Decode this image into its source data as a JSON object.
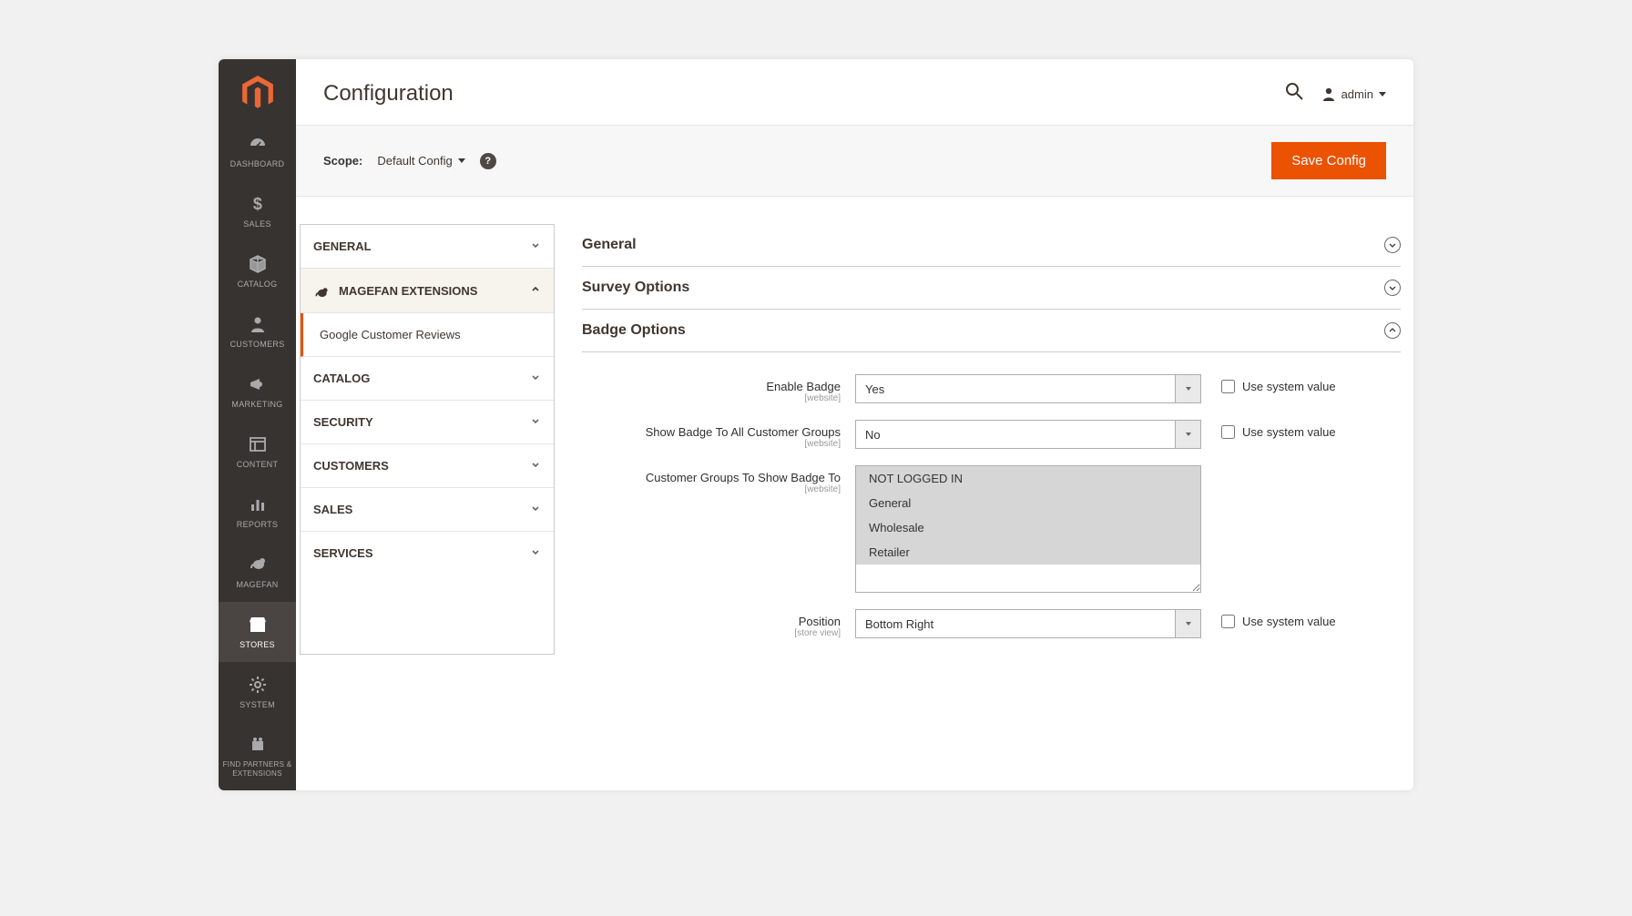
{
  "header": {
    "title": "Configuration",
    "user": "admin"
  },
  "scope": {
    "label": "Scope:",
    "value": "Default Config",
    "save_label": "Save Config"
  },
  "sidebar": [
    {
      "label": "DASHBOARD",
      "icon": "dashboard"
    },
    {
      "label": "SALES",
      "icon": "dollar"
    },
    {
      "label": "CATALOG",
      "icon": "cube"
    },
    {
      "label": "CUSTOMERS",
      "icon": "person"
    },
    {
      "label": "MARKETING",
      "icon": "megaphone"
    },
    {
      "label": "CONTENT",
      "icon": "layout"
    },
    {
      "label": "REPORTS",
      "icon": "bars"
    },
    {
      "label": "MAGEFAN",
      "icon": "elephant"
    },
    {
      "label": "STORES",
      "icon": "store",
      "active": true
    },
    {
      "label": "SYSTEM",
      "icon": "gear"
    },
    {
      "label": "FIND PARTNERS & EXTENSIONS",
      "icon": "partners"
    }
  ],
  "tabs": [
    {
      "label": "GENERAL",
      "expanded": false
    },
    {
      "label": "MAGEFAN EXTENSIONS",
      "expanded": true,
      "subitems": [
        "Google Customer Reviews"
      ]
    },
    {
      "label": "CATALOG",
      "expanded": false
    },
    {
      "label": "SECURITY",
      "expanded": false
    },
    {
      "label": "CUSTOMERS",
      "expanded": false
    },
    {
      "label": "SALES",
      "expanded": false
    },
    {
      "label": "SERVICES",
      "expanded": false
    }
  ],
  "sections": {
    "general": {
      "title": "General",
      "open": false
    },
    "survey": {
      "title": "Survey Options",
      "open": false
    },
    "badge": {
      "title": "Badge Options",
      "open": true,
      "fields": {
        "enable": {
          "label": "Enable Badge",
          "scope": "[website]",
          "value": "Yes",
          "sys_label": "Use system value"
        },
        "showall": {
          "label": "Show Badge To All Customer Groups",
          "scope": "[website]",
          "value": "No",
          "sys_label": "Use system value"
        },
        "groups": {
          "label": "Customer Groups To Show Badge To",
          "scope": "[website]",
          "options": [
            "NOT LOGGED IN",
            "General",
            "Wholesale",
            "Retailer"
          ]
        },
        "position": {
          "label": "Position",
          "scope": "[store view]",
          "value": "Bottom Right",
          "sys_label": "Use system value"
        }
      }
    }
  }
}
